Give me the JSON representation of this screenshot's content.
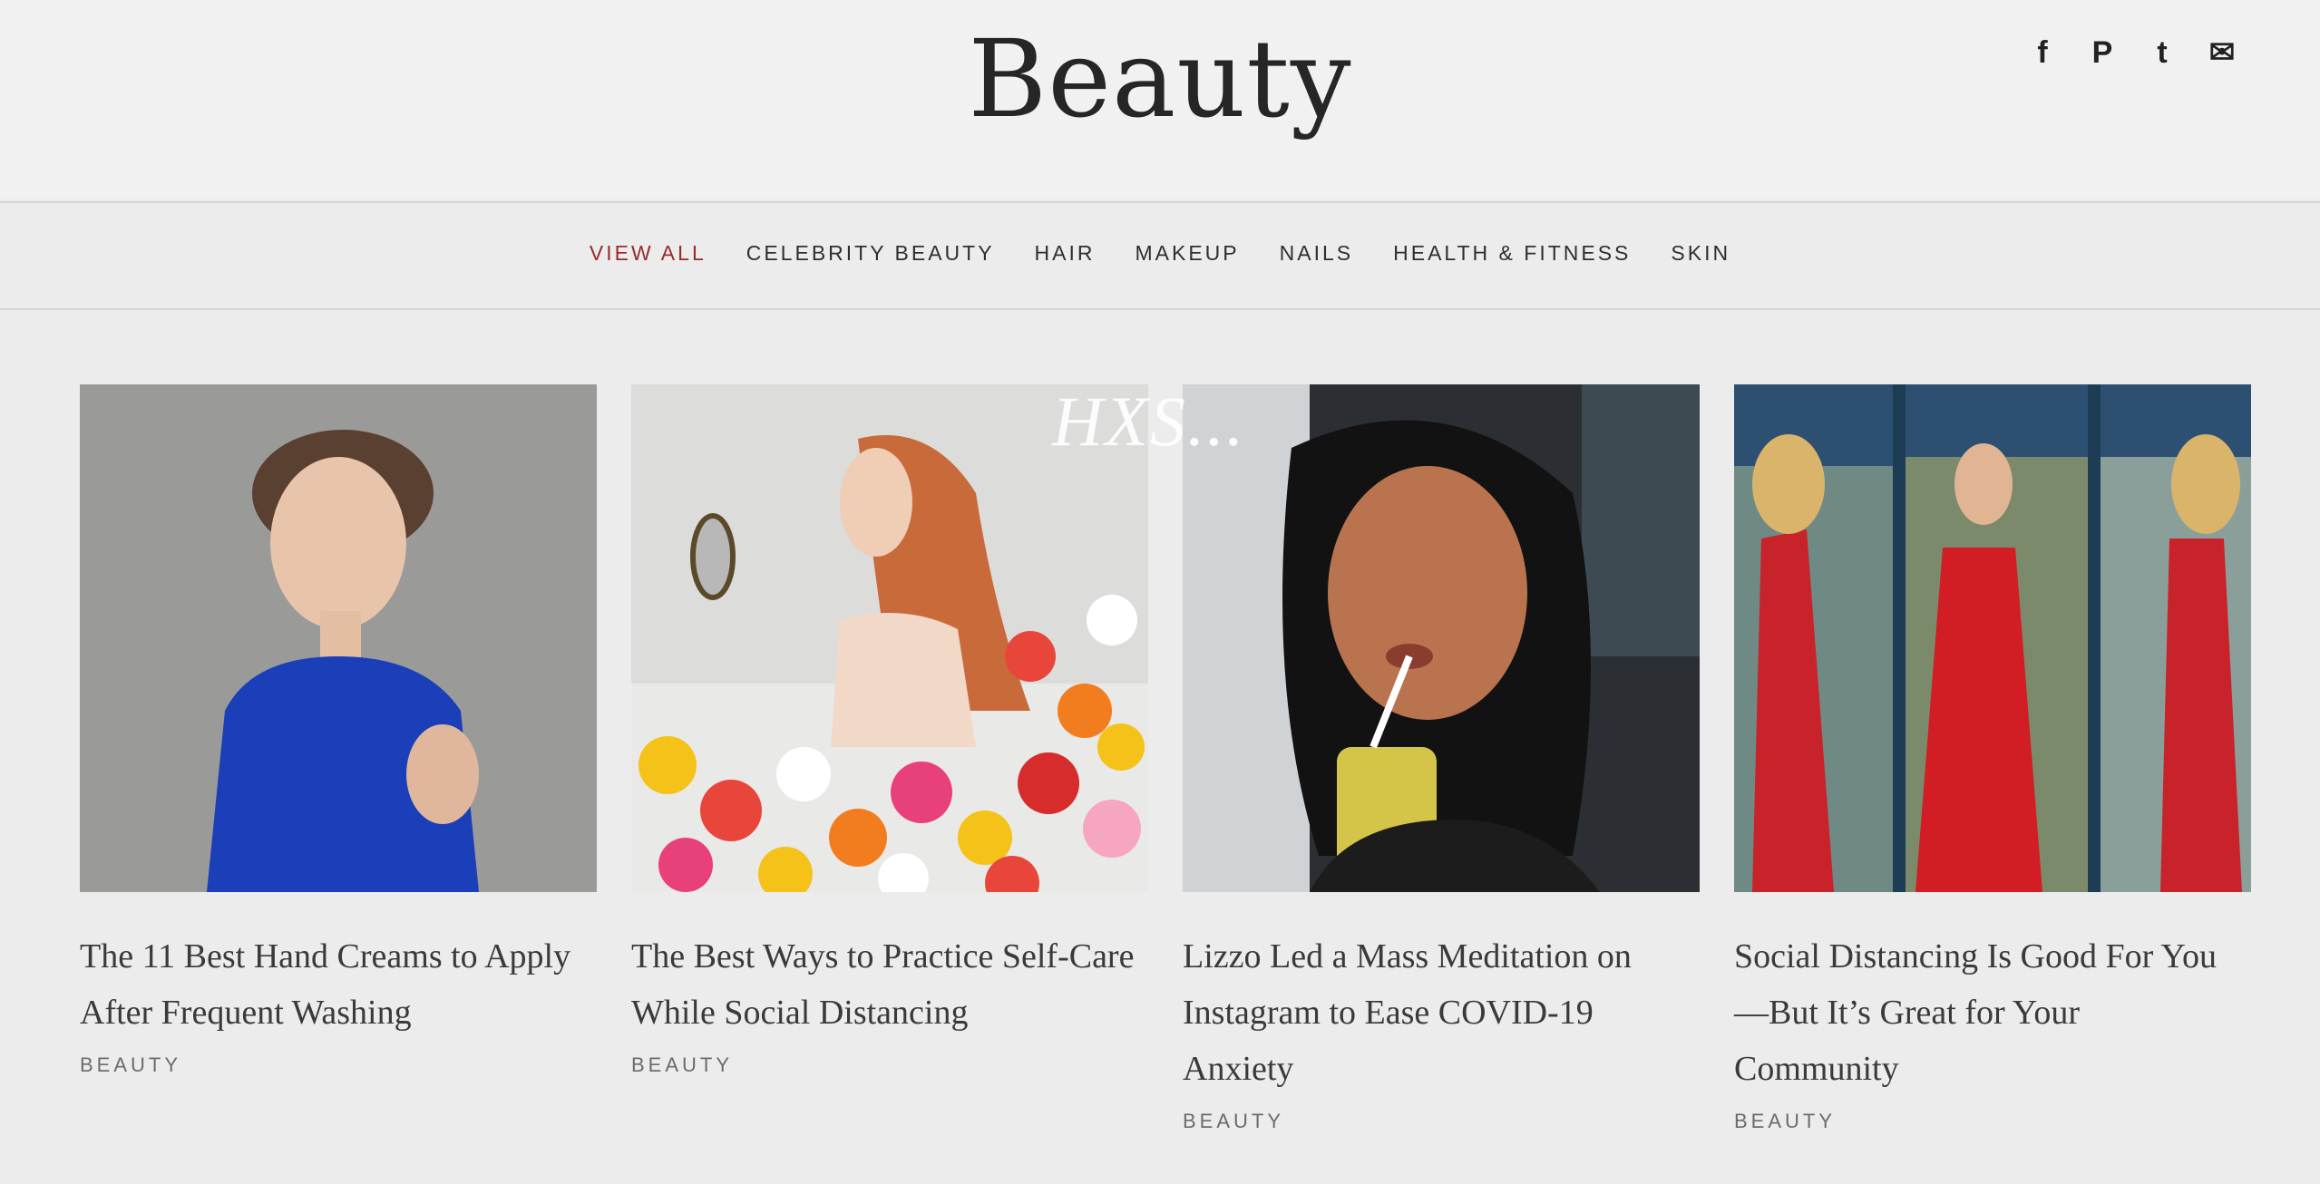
{
  "header": {
    "title": "Beauty"
  },
  "social": {
    "facebook": "f",
    "pinterest": "P",
    "twitter": "t",
    "email": "✉"
  },
  "nav": {
    "items": [
      {
        "label": "VIEW ALL",
        "active": true
      },
      {
        "label": "CELEBRITY BEAUTY"
      },
      {
        "label": "HAIR"
      },
      {
        "label": "MAKEUP"
      },
      {
        "label": "NAILS"
      },
      {
        "label": "HEALTH & FITNESS"
      },
      {
        "label": "SKIN"
      }
    ]
  },
  "watermark": "HXS...",
  "cards": [
    {
      "title": "The 11 Best Hand Creams to Apply After Frequent Washing",
      "category": "BEAUTY",
      "image": "model-blue-top-photo"
    },
    {
      "title": "The Best Ways to Practice Self-Care While Social Distancing",
      "category": "BEAUTY",
      "image": "woman-with-mirror-and-flowers-photo"
    },
    {
      "title": "Lizzo Led a Mass Meditation on Instagram to Ease COVID-19 Anxiety",
      "category": "BEAUTY",
      "image": "lizzo-with-drink-photo"
    },
    {
      "title": "Social Distancing Is Good For You—But It’s Great for Your Community",
      "category": "BEAUTY",
      "image": "women-in-red-dresses-photo"
    }
  ],
  "colors": {
    "accent": "#9a2b2b",
    "text": "#2a2a2a",
    "background": "#ececec"
  }
}
